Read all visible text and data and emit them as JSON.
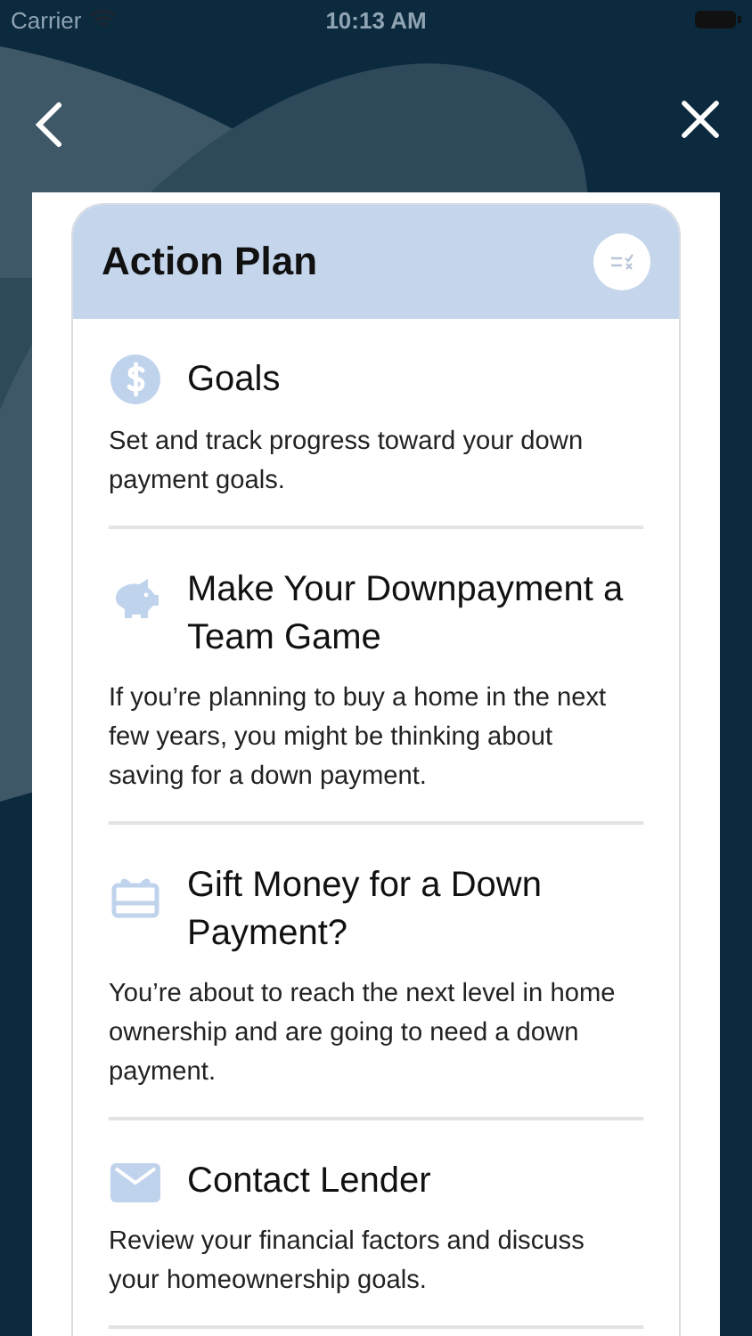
{
  "status_bar": {
    "carrier": "Carrier",
    "time": "10:13 AM"
  },
  "card": {
    "title": "Action Plan"
  },
  "items": [
    {
      "kind": "dollar",
      "title": "Goals",
      "description": "Set and track progress toward your down payment goals."
    },
    {
      "kind": "piggy",
      "title": "Make Your Downpayment a Team Game",
      "description": "If you’re planning to buy a home in the next few years, you might be thinking about saving for a down payment."
    },
    {
      "kind": "gift",
      "title": "Gift Money for a Down Payment?",
      "description": "You’re about to reach the next level in home ownership and are going to need a down payment."
    },
    {
      "kind": "mail",
      "title": "Contact Lender",
      "description": "Review your financial factors and discuss your homeownership goals."
    }
  ]
}
